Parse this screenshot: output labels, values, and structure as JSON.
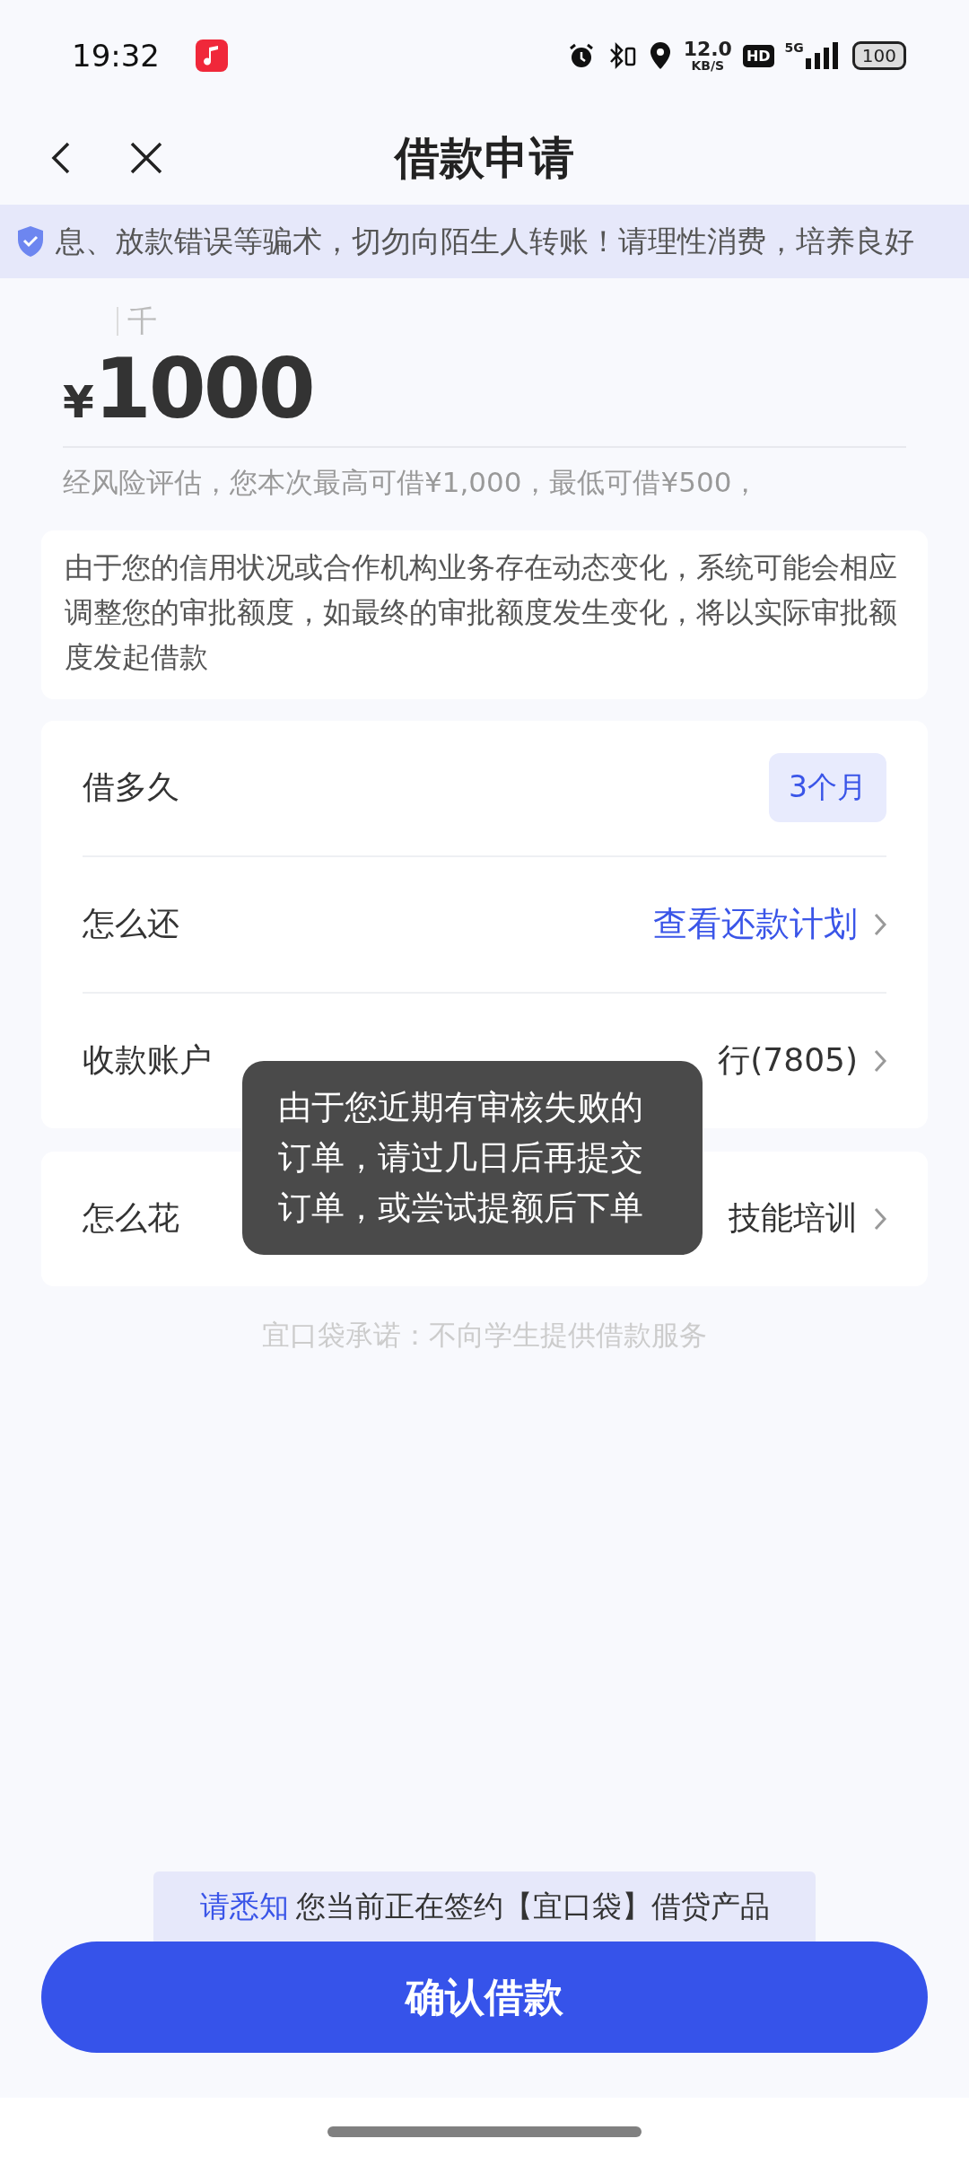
{
  "status_bar": {
    "time": "19:32",
    "speed_value": "12.0",
    "speed_unit": "KB/S",
    "hd": "HD",
    "network": "5G",
    "battery": "100"
  },
  "nav": {
    "title": "借款申请"
  },
  "notice_banner": {
    "text": "息、放款错误等骗术，切勿向陌生人转账！请理性消费，培养良好"
  },
  "amount": {
    "unit_hint": "千",
    "currency": "¥",
    "value": "1000",
    "range_note": "经风险评估，您本次最高可借¥1,000，最低可借¥500，"
  },
  "info_card": {
    "text": "由于您的信用状况或合作机构业务存在动态变化，系统可能会相应调整您的审批额度，如最终的审批额度发生变化，将以实际审批额度发起借款"
  },
  "cards": [
    {
      "rows": [
        {
          "kind": "tag",
          "label": "借多久",
          "value": "3个月"
        },
        {
          "kind": "link",
          "label": "怎么还",
          "value": "查看还款计划"
        },
        {
          "kind": "plain",
          "label": "收款账户",
          "value": "行(7805)"
        }
      ]
    },
    {
      "rows": [
        {
          "kind": "plain",
          "label": "怎么花",
          "value": "技能培训"
        }
      ]
    }
  ],
  "promise": "宜口袋承诺：不向学生提供借款服务",
  "toast": {
    "text": "由于您近期有审核失败的订单，请过几日后再提交订单，或尝试提额后下单"
  },
  "sign_notice": {
    "lead": "请悉知",
    "text": "您当前正在签约【宜口袋】借贷产品"
  },
  "confirm_button": "确认借款"
}
